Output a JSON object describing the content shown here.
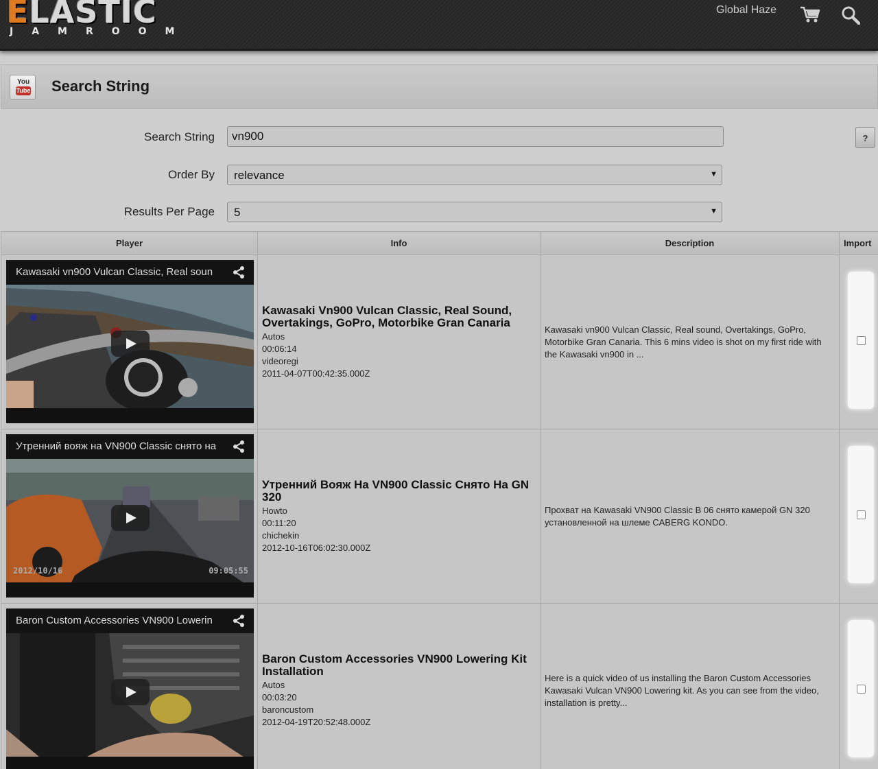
{
  "header": {
    "logo_first_letter": "E",
    "logo_rest": "LASTIC",
    "logo_sub": "JAMROOM",
    "user": "Global Haze",
    "cart_icon": "cart-icon",
    "search_icon": "search-icon"
  },
  "page": {
    "title": "Search String",
    "icon": "youtube-icon",
    "icon_you": "You",
    "icon_tube": "Tube"
  },
  "form": {
    "search_label": "Search String",
    "search_value": "vn900",
    "order_label": "Order By",
    "order_value": "relevance",
    "per_page_label": "Results Per Page",
    "per_page_value": "5",
    "help_label": "?"
  },
  "table": {
    "headers": [
      "Player",
      "Info",
      "Description",
      "Import"
    ],
    "rows": [
      {
        "player_title": "Kawasaki vn900 Vulcan Classic, Real soun",
        "title": "Kawasaki Vn900 Vulcan Classic, Real Sound, Overtakings, GoPro, Motorbike Gran Canaria",
        "category": "Autos",
        "duration": "00:06:14",
        "author": "videoregi",
        "date": "2011-04-07T00:42:35.000Z",
        "description": "Kawasaki vn900 Vulcan Classic, Real sound, Overtakings, GoPro, Motorbike Gran Canaria. This 6 mins video is shot on my first ride with the Kawasaki vn900 in ...",
        "stamp_left": "",
        "stamp_right": ""
      },
      {
        "player_title": "Утренний вояж на VN900 Classic снято на",
        "title": "Утренний Вояж На VN900 Classic Снято На GN 320",
        "category": "Howto",
        "duration": "00:11:20",
        "author": "chichekin",
        "date": "2012-10-16T06:02:30.000Z",
        "description": "Прохват на Kawasaki VN900 Classic B 06 снято камерой GN 320 установленной на шлеме CABERG KONDO.",
        "stamp_left": "2012/10/16",
        "stamp_right": "09:05:55"
      },
      {
        "player_title": "Baron Custom Accessories VN900 Lowerin",
        "title": "Baron Custom Accessories VN900 Lowering Kit Installation",
        "category": "Autos",
        "duration": "00:03:20",
        "author": "baroncustom",
        "date": "2012-04-19T20:52:48.000Z",
        "description": "Here is a quick video of us installing the Baron Custom Accessories Kawasaki Vulcan VN900 Lowering kit. As you can see from the video, installation is pretty...",
        "stamp_left": "",
        "stamp_right": ""
      }
    ]
  }
}
